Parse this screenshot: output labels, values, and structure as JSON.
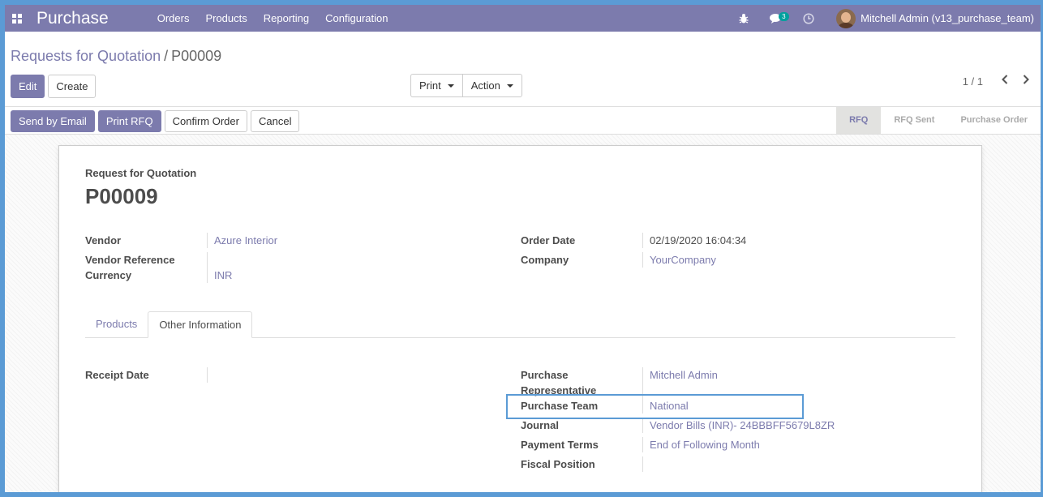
{
  "app": {
    "title": "Purchase"
  },
  "menu": [
    "Orders",
    "Products",
    "Reporting",
    "Configuration"
  ],
  "navbar": {
    "bug_icon": "bug-icon",
    "chat_icon": "chat-icon",
    "chat_badge": "3",
    "clock_icon": "clock-icon",
    "user_name": "Mitchell Admin (v13_purchase_team)"
  },
  "breadcrumb": {
    "parent": "Requests for Quotation",
    "separator": "/",
    "current": "P00009"
  },
  "control": {
    "edit_label": "Edit",
    "create_label": "Create",
    "print_label": "Print",
    "action_label": "Action",
    "pager_value": "1 / 1"
  },
  "statusbar": {
    "buttons": [
      "Send by Email",
      "Print RFQ",
      "Confirm Order",
      "Cancel"
    ],
    "stages": [
      "RFQ",
      "RFQ Sent",
      "Purchase Order"
    ],
    "active_stage": "RFQ"
  },
  "form": {
    "doc_type": "Request for Quotation",
    "doc_name": "P00009",
    "left_fields": [
      {
        "label": "Vendor",
        "value": "Azure Interior"
      },
      {
        "label": "Vendor Reference",
        "value": ""
      },
      {
        "label": "Currency",
        "value": "INR"
      }
    ],
    "right_fields": [
      {
        "label": "Order Date",
        "value": "02/19/2020 16:04:34"
      },
      {
        "label": "Company",
        "value": "YourCompany"
      }
    ],
    "tabs": [
      "Products",
      "Other Information"
    ],
    "active_tab": "Other Information",
    "other_info_left": [
      {
        "label": "Receipt Date",
        "value": ""
      }
    ],
    "other_info_right": [
      {
        "label": "Purchase Representative",
        "value": "Mitchell Admin"
      },
      {
        "label": "Purchase Team",
        "value": "National"
      },
      {
        "label": "Journal",
        "value": "Vendor Bills (INR)- 24BBBFF5679L8ZR"
      },
      {
        "label": "Payment Terms",
        "value": "End of Following Month"
      },
      {
        "label": "Fiscal Position",
        "value": ""
      }
    ]
  },
  "colors": {
    "brand": "#7c7bad",
    "highlight": "#5b9bd5",
    "badge": "#00a09d"
  }
}
